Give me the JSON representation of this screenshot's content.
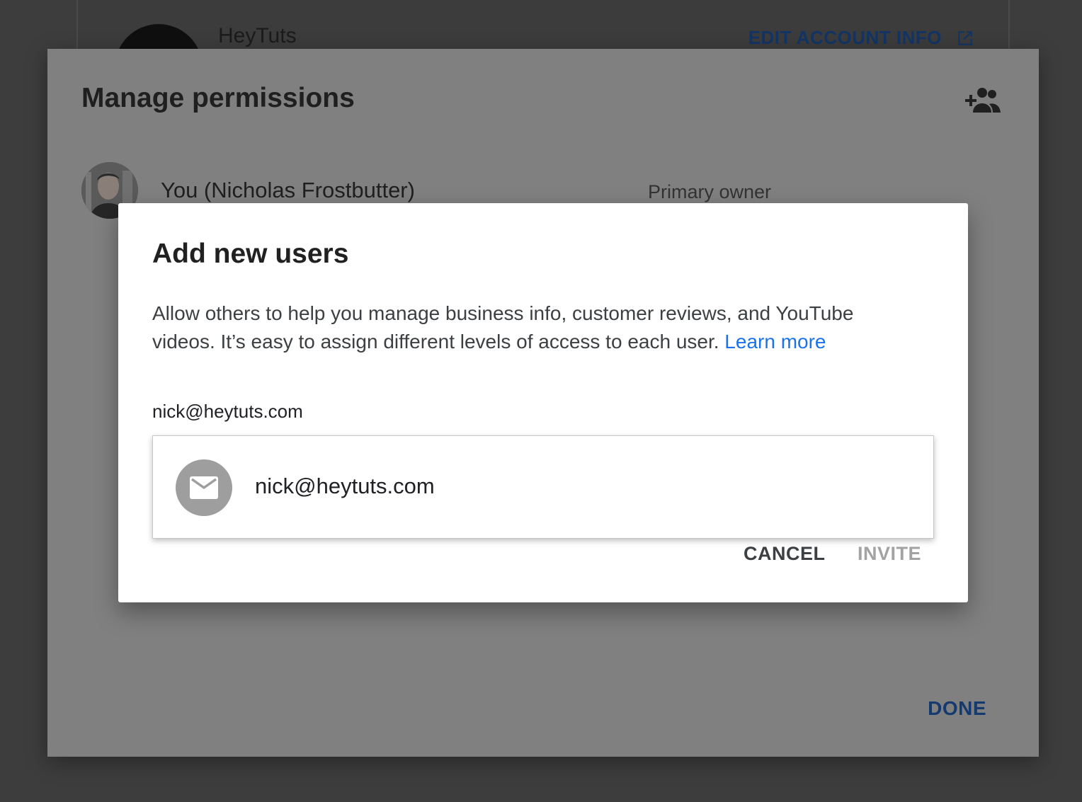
{
  "account_card": {
    "name": "HeyTuts",
    "edit_label": "EDIT ACCOUNT INFO",
    "edit_icon": "open-in-new-icon"
  },
  "permissions_dialog": {
    "title": "Manage permissions",
    "add_icon": "add-person-icon",
    "owner": {
      "name": "You (Nicholas Frostbutter)",
      "role": "Primary owner"
    },
    "done_label": "DONE"
  },
  "add_users_dialog": {
    "title": "Add new users",
    "description": "Allow others to help you manage business info, customer reviews, and YouTube videos. It’s easy to assign different levels of access to each user.",
    "learn_more": "Learn more",
    "input_value": "nick@heytuts.com",
    "suggestion": {
      "email": "nick@heytuts.com",
      "icon": "mail-icon"
    },
    "cancel_label": "CANCEL",
    "invite_label": "INVITE"
  },
  "colors": {
    "link": "#1a73e8",
    "dim_overlay": "#808080",
    "backdrop": "#3d3d3d",
    "disabled_text": "#a3a3a3"
  }
}
